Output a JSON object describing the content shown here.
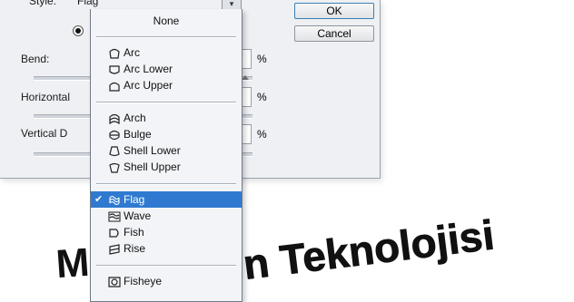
{
  "dialog": {
    "style_label": "Style:",
    "style_value": "Flag",
    "bend_label": "Bend:",
    "horizontal_label": "Horizontal",
    "vertical_label": "Vertical D",
    "percent": "%",
    "ok_label": "OK",
    "cancel_label": "Cancel"
  },
  "dropdown": {
    "none": "None",
    "group1": [
      {
        "label": "Arc",
        "icon": "arc-icon"
      },
      {
        "label": "Arc Lower",
        "icon": "arc-lower-icon"
      },
      {
        "label": "Arc Upper",
        "icon": "arc-upper-icon"
      }
    ],
    "group2": [
      {
        "label": "Arch",
        "icon": "arch-icon"
      },
      {
        "label": "Bulge",
        "icon": "bulge-icon"
      },
      {
        "label": "Shell Lower",
        "icon": "shell-lower-icon"
      },
      {
        "label": "Shell Upper",
        "icon": "shell-upper-icon"
      }
    ],
    "group3": [
      {
        "label": "Flag",
        "icon": "flag-icon",
        "selected": true
      },
      {
        "label": "Wave",
        "icon": "wave-icon"
      },
      {
        "label": "Fish",
        "icon": "fish-icon"
      },
      {
        "label": "Rise",
        "icon": "rise-icon"
      }
    ],
    "group4": [
      {
        "label": "Fisheye",
        "icon": "fisheye-icon"
      }
    ],
    "selected_color": "#2f7ad0"
  },
  "warped_text": {
    "left": "M",
    "right": "n Teknolojisi"
  }
}
